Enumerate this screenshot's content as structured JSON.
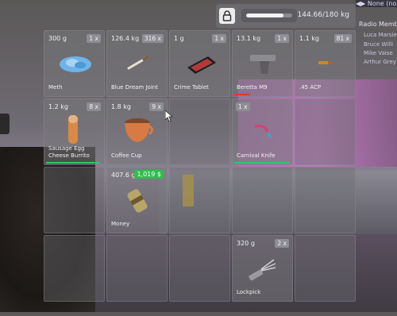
{
  "radio": {
    "channel": "◀▶ None (none)",
    "title": "Radio Members",
    "members": [
      "Luca Marsiello",
      "Bruce Willi",
      "Mike Vaise",
      "Arthur Grey"
    ]
  },
  "weight": {
    "text": "144.66/180 kg",
    "fraction": 0.8037
  },
  "slots": [
    {
      "weight": "300 g",
      "count": "1 x",
      "label": "Meth",
      "icon": "meth-crystals-icon"
    },
    {
      "weight": "126.4 kg",
      "count": "316 x",
      "label": "Blue Dream Joint",
      "icon": "joint-icon"
    },
    {
      "weight": "1 g",
      "count": "1 x",
      "label": "Crime Tablet",
      "icon": "tablet-icon"
    },
    {
      "weight": "13.1 kg",
      "count": "1 x",
      "label": "Beretta M9",
      "icon": "pistol-icon",
      "durability": 0.28,
      "durability_color": "#e03a2a"
    },
    {
      "weight": "1.1 kg",
      "count": "81 x",
      "label": ".45 ACP",
      "icon": "bullet-icon"
    },
    {
      "weight": "1.2 kg",
      "count": "8 x",
      "label": "Sausage Egg Cheese Burrito",
      "icon": "burrito-icon",
      "durability": 0.93,
      "durability_color": "#35c46a"
    },
    {
      "weight": "1.8 kg",
      "count": "9 x",
      "label": "Coffee Cup",
      "icon": "coffee-cup-icon"
    },
    {
      "count": "1 x",
      "label": "Carnival Knife",
      "icon": "knife-icon",
      "durability": 0.96,
      "durability_color": "#35c46a"
    },
    {
      "weight": "407.6 g",
      "money": "1,019 $",
      "label": "Money",
      "icon": "money-roll-icon"
    },
    {
      "weight": "320 g",
      "count": "2 x",
      "label": "Lockpick",
      "icon": "lockpick-icon"
    }
  ]
}
